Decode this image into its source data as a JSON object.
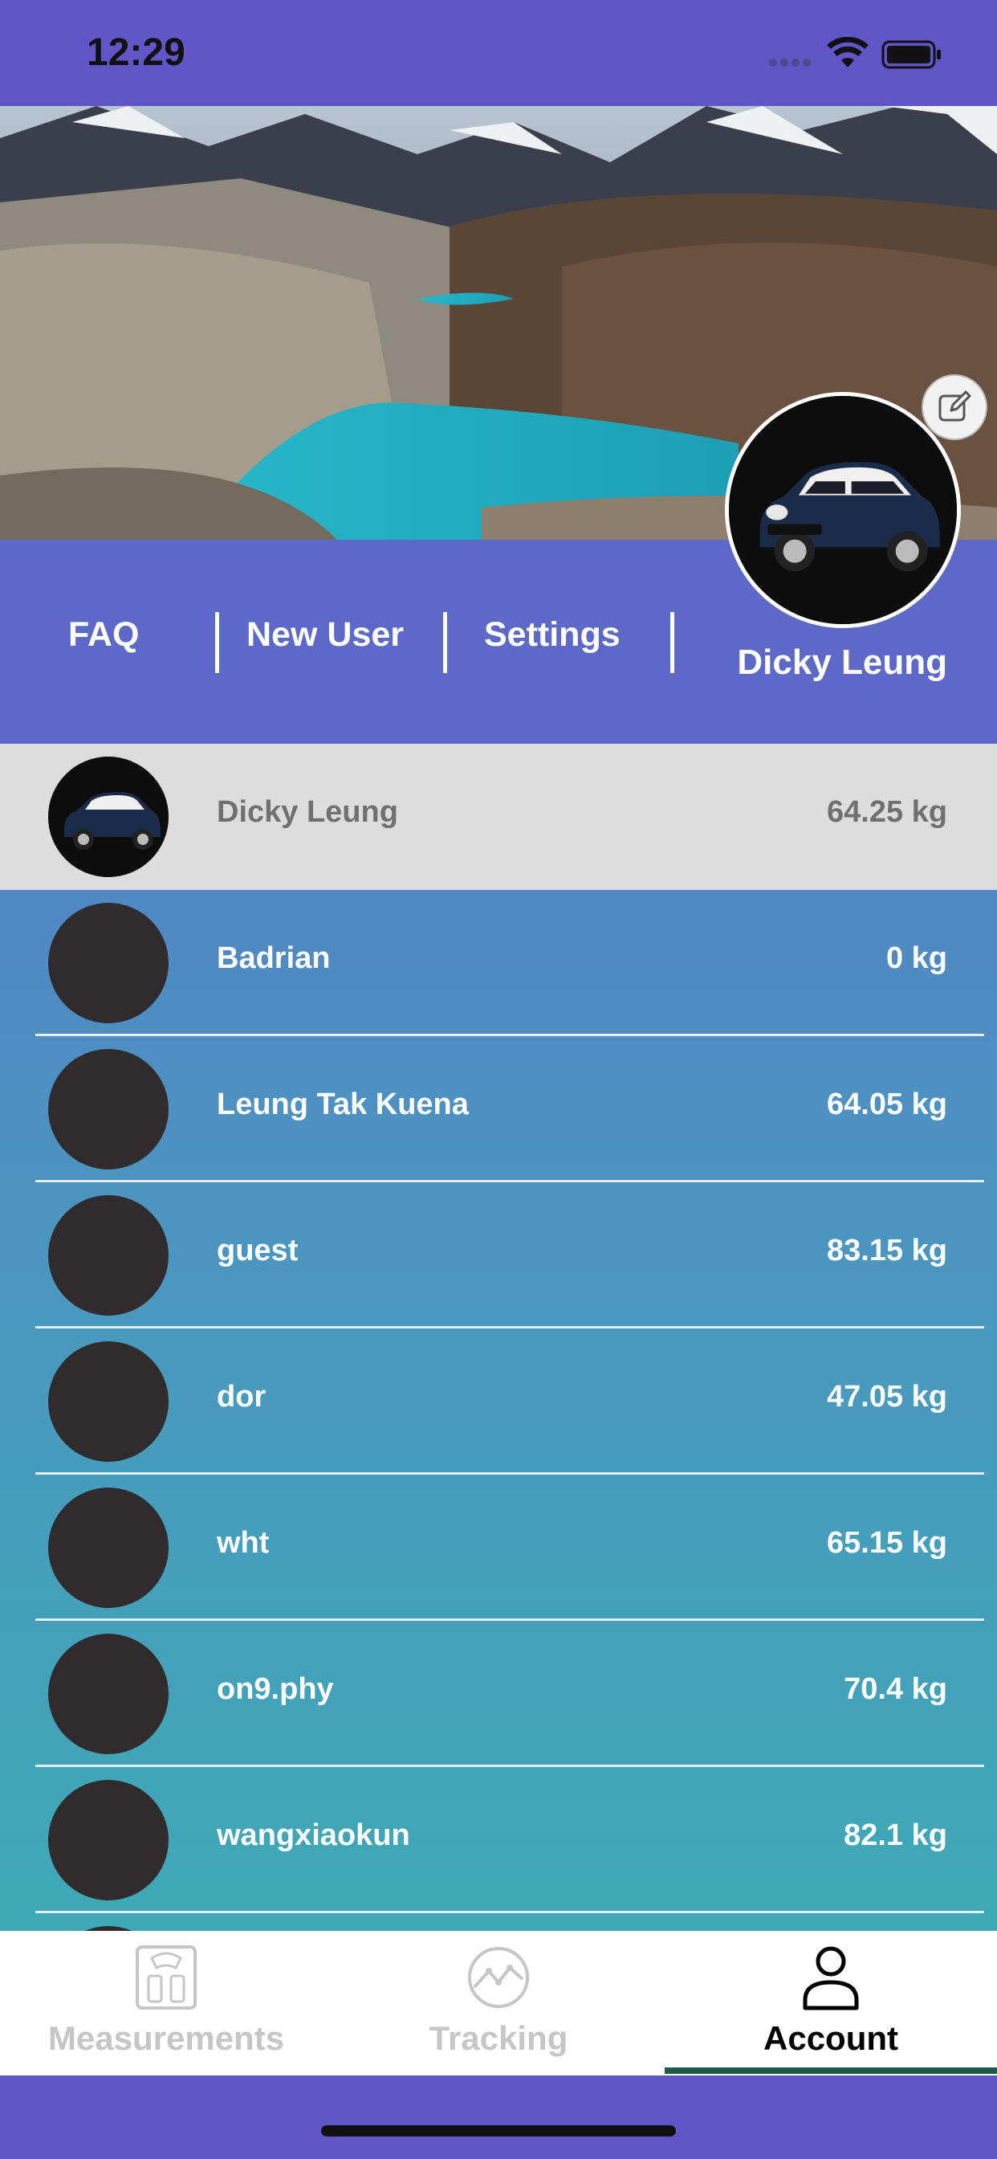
{
  "status_bar": {
    "time": "12:29"
  },
  "header": {
    "nav": {
      "faq": "FAQ",
      "new_user": "New User",
      "settings": "Settings"
    },
    "profile_name": "Dicky Leung"
  },
  "users": [
    {
      "name": "Dicky Leung",
      "weight": "64.25 kg"
    },
    {
      "name": "Badrian",
      "weight": "0 kg"
    },
    {
      "name": "Leung Tak Kuena",
      "weight": "64.05 kg"
    },
    {
      "name": "guest",
      "weight": "83.15 kg"
    },
    {
      "name": "dor",
      "weight": "47.05 kg"
    },
    {
      "name": "wht",
      "weight": "65.15 kg"
    },
    {
      "name": "on9.phy",
      "weight": "70.4 kg"
    },
    {
      "name": "wangxiaokun",
      "weight": "82.1 kg"
    }
  ],
  "tabs": [
    {
      "label": "Measurements",
      "icon": "scale-icon",
      "active": false
    },
    {
      "label": "Tracking",
      "icon": "chart-line-icon",
      "active": false
    },
    {
      "label": "Account",
      "icon": "person-icon",
      "active": true
    }
  ],
  "colors": {
    "header_band": "#5d69c9",
    "status_bar": "#6056c8",
    "list_gradient_top": "#5381c6",
    "list_gradient_bottom": "#3ea9b6",
    "selected_row": "#dddddd",
    "tab_indicator": "#1f5a4a"
  }
}
